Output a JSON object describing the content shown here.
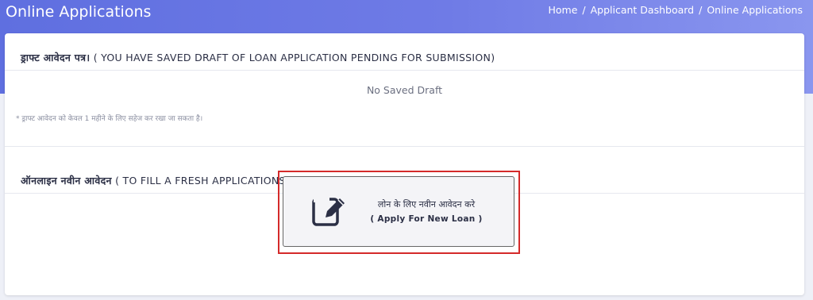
{
  "header": {
    "title": "Online Applications",
    "breadcrumb": [
      "Home",
      "Applicant Dashboard",
      "Online Applications"
    ],
    "separator": "/"
  },
  "draft_section": {
    "heading_hindi": "ड्राफ्ट आवेदन पत्र।",
    "heading_english": "( YOU HAVE SAVED DRAFT OF LOAN APPLICATION PENDING FOR SUBMISSION)",
    "empty_message": "No Saved Draft",
    "footnote": "* ड्राफ्ट आवेदन को केवल 1 महीने के लिए सहेज कर रखा जा सकता है।"
  },
  "new_section": {
    "heading_hindi": "ऑनलाइन नवीन आवेदन",
    "heading_english": "( TO FILL A FRESH APPLICATIONS )"
  },
  "apply_button": {
    "label_hindi": "लोन के लिए नवीन आवेदन करे",
    "label_english": "( Apply For New Loan )",
    "icon": "edit-icon"
  },
  "colors": {
    "banner": "#6f7be6",
    "highlight_border": "#d42a2a",
    "text_dark": "#2b2f45"
  }
}
